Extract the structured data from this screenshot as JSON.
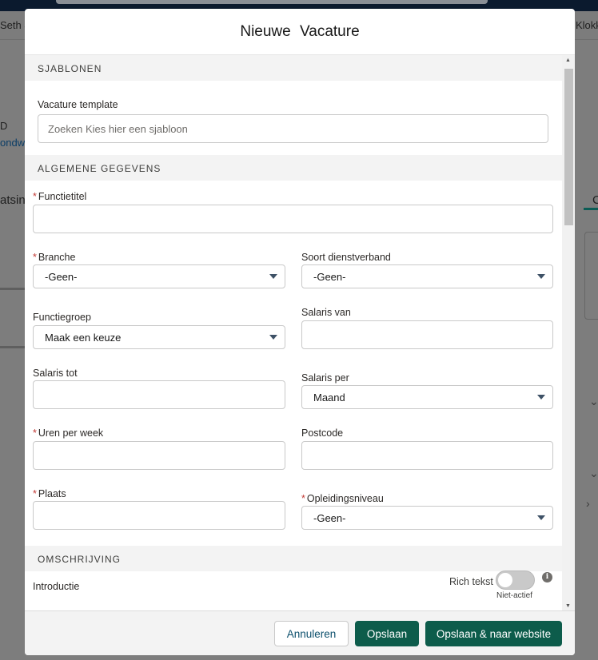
{
  "background": {
    "left_fragment_1": "Seth &",
    "left_fragment_2": "D",
    "left_link": "ondw",
    "left_fragment_3": "atsin",
    "right_fragment_1": "Klokk",
    "right_fragment_2": "C"
  },
  "modal": {
    "title": "Nieuwe   Vacature",
    "sections": {
      "templates": "SJABLONEN",
      "general": "ALGEMENE GEGEVENS",
      "description": "OMSCHRIJVING"
    },
    "template_field": {
      "label": "Vacature template",
      "placeholder": "Zoeken Kies hier een sjabloon"
    },
    "fields": {
      "job_title": {
        "label": "Functietitel",
        "required": true,
        "value": ""
      },
      "branch": {
        "label": "Branche",
        "required": true,
        "value": "-Geen-"
      },
      "employment_type": {
        "label": "Soort dienstverband",
        "required": false,
        "value": "-Geen-"
      },
      "job_group": {
        "label": "Functiegroep",
        "required": false,
        "value": "Maak een keuze"
      },
      "salary_from": {
        "label": "Salaris van",
        "required": false,
        "value": ""
      },
      "salary_to": {
        "label": "Salaris tot",
        "required": false,
        "value": ""
      },
      "salary_per": {
        "label": "Salaris per",
        "required": false,
        "value": "Maand"
      },
      "hours_per_week": {
        "label": "Uren per week",
        "required": true,
        "value": ""
      },
      "postcode": {
        "label": "Postcode",
        "required": false,
        "value": ""
      },
      "place": {
        "label": "Plaats",
        "required": true,
        "value": ""
      },
      "education_level": {
        "label": "Opleidingsniveau",
        "required": true,
        "value": "-Geen-"
      }
    },
    "introduction": {
      "label": "Introductie",
      "rich_text_label": "Rich tekst",
      "toggle_state": "Niet-actief"
    },
    "footer": {
      "cancel": "Annuleren",
      "save": "Opslaan",
      "save_and_website": "Opslaan & naar website"
    }
  },
  "colors": {
    "brand": "#0d5c4b",
    "required": "#c23934",
    "overlay": "#7d7d7d"
  }
}
